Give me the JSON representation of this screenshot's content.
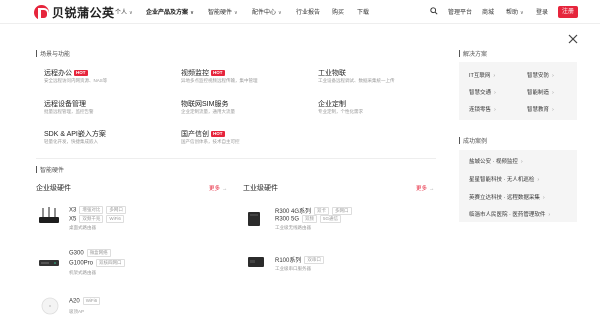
{
  "header": {
    "logo_text": "贝锐蒲公英",
    "nav": [
      {
        "label": "个人",
        "caret": true
      },
      {
        "label": "企业产品及方案",
        "caret": true,
        "active": true
      },
      {
        "label": "智能硬件",
        "caret": true
      },
      {
        "label": "配件中心",
        "caret": true
      },
      {
        "label": "行业报告"
      },
      {
        "label": "购买"
      },
      {
        "label": "下载"
      }
    ],
    "right_links": [
      "管理平台",
      "商城",
      "帮助",
      "登录"
    ],
    "help_caret": true,
    "register_label": "注册",
    "accent_color": "#e6253c"
  },
  "scenarios": {
    "title": "场景与功能",
    "items": [
      {
        "title": "远程办公",
        "hot": true,
        "desc": "安全远程访问内网资源、NAS等"
      },
      {
        "title": "视频监控",
        "hot": true,
        "desc": "异地多点监控视频远程传输，集中管理"
      },
      {
        "title": "工业物联",
        "hot": false,
        "desc": "工业设备远程调试、数据采集统一上传"
      },
      {
        "title": "远程设备管理",
        "hot": false,
        "desc": "批量远程管理，监控告警"
      },
      {
        "title": "物联网SIM服务",
        "hot": false,
        "desc": "企业定制流量，通用大流量"
      },
      {
        "title": "企业定制",
        "hot": false,
        "desc": "专业定制，个性化需求"
      },
      {
        "title": "SDK & API嵌入方案",
        "hot": false,
        "desc": "轻量化开发，快捷集成嵌入"
      },
      {
        "title": "国产信创",
        "hot": true,
        "desc": "国产信创体系，技术自主可控"
      }
    ],
    "hot_label": "HOT"
  },
  "hardware": {
    "title": "智能硬件",
    "enterprise": {
      "title": "企业级硬件",
      "more": "更多",
      "products": [
        {
          "names": [
            "X3",
            "X5"
          ],
          "tags": [
            [
              "增强对比",
              "多网口"
            ],
            [
              "双频千兆",
              "WiFi6"
            ]
          ],
          "desc": "桌面式路由器"
        },
        {
          "names": [
            "G300",
            "G100Pro"
          ],
          "tags": [
            [
              "微盒网络"
            ],
            [
              "双核四网口"
            ]
          ],
          "desc": "机架式路由器"
        },
        {
          "names": [
            "A20"
          ],
          "tags": [
            [
              "WiFi6"
            ]
          ],
          "desc": "吸顶AP"
        }
      ]
    },
    "industrial": {
      "title": "工业级硬件",
      "more": "更多",
      "products": [
        {
          "names": [
            "R300 4G系列",
            "R300 5G"
          ],
          "tags": [
            [
              "双卡",
              "多网口"
            ],
            [
              "双频",
              "5G通信"
            ]
          ],
          "desc": "工业级无线路由器"
        },
        {
          "names": [
            "R100系列"
          ],
          "tags": [
            [
              "双串口"
            ]
          ],
          "desc": "工业级串口服务器"
        }
      ]
    }
  },
  "solutions": {
    "title": "解决方案",
    "links": [
      "IT互联网",
      "智慧安防",
      "智慧交通",
      "智能制造",
      "连锁零售",
      "智慧教育"
    ]
  },
  "cases": {
    "title": "成功案例",
    "links": [
      "盐城公安 · 视频监控",
      "星星智能科技 · 无人机巡检",
      "英赛立达科技 · 远程数据采集",
      "临淄市人民医院 · 医药管理软件"
    ]
  }
}
